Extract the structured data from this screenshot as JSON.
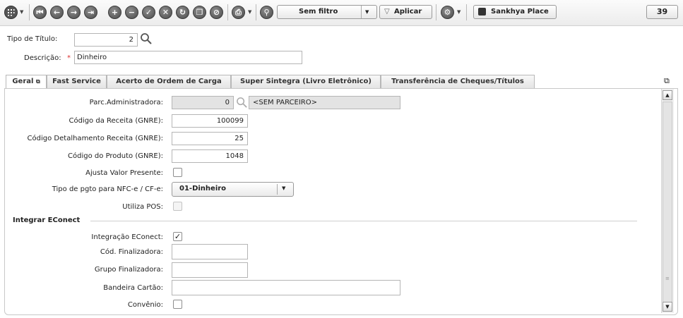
{
  "toolbar": {
    "filter_label": "Sem filtro",
    "apply_label": "Aplicar",
    "place_label": "Sankhya Place",
    "record_count": "39"
  },
  "header": {
    "tipo_titulo_label": "Tipo de Título:",
    "tipo_titulo_value": "2",
    "descricao_label": "Descrição:",
    "descricao_value": "Dinheiro",
    "required_mark": "*"
  },
  "tabs": [
    {
      "label": "Geral"
    },
    {
      "label": "Fast Service"
    },
    {
      "label": "Acerto de Ordem de Carga"
    },
    {
      "label": "Super Sintegra (Livro Eletrônico)"
    },
    {
      "label": "Transferência de Cheques/Títulos"
    }
  ],
  "form": {
    "parc_admin_label": "Parc.Administradora:",
    "parc_admin_value": "0",
    "parc_admin_name": "<SEM PARCEIRO>",
    "cod_receita_label": "Código da Receita (GNRE):",
    "cod_receita_value": "100099",
    "cod_det_label": "Código Detalhamento Receita (GNRE):",
    "cod_det_value": "25",
    "cod_prod_label": "Código do Produto (GNRE):",
    "cod_prod_value": "1048",
    "ajusta_label": "Ajusta Valor Presente:",
    "tipo_pgto_label": "Tipo de pgto para NFC-e / CF-e:",
    "tipo_pgto_value": "01-Dinheiro",
    "utiliza_pos_label": "Utiliza POS:",
    "section_title": "Integrar EConect",
    "integracao_label": "Integração EConect:",
    "integracao_checked": "✓",
    "cod_final_label": "Cód. Finalizadora:",
    "grupo_final_label": "Grupo Finalizadora:",
    "bandeira_label": "Bandeira Cartão:",
    "convenio_label": "Convênio:"
  }
}
